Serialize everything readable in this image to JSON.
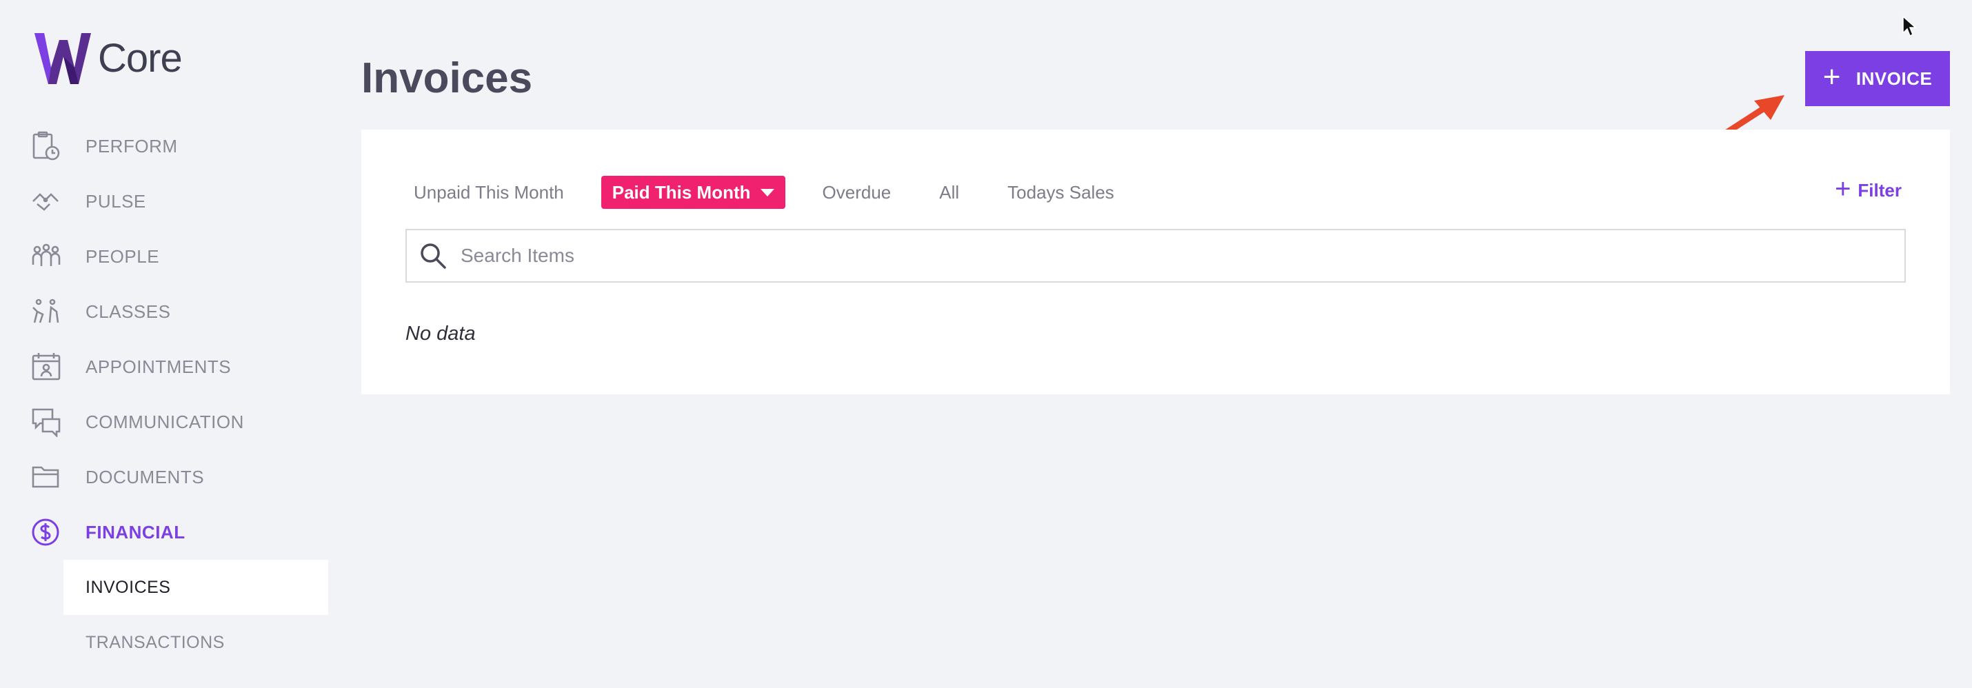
{
  "brand": {
    "logo_text": "Core",
    "accent_color": "#7b3fe4",
    "tab_active_color": "#f0226f"
  },
  "sidebar": {
    "items": [
      {
        "label": "PERFORM",
        "icon": "clipboard-clock-icon"
      },
      {
        "label": "PULSE",
        "icon": "pulse-icon"
      },
      {
        "label": "PEOPLE",
        "icon": "people-group-icon"
      },
      {
        "label": "CLASSES",
        "icon": "classes-figures-icon"
      },
      {
        "label": "APPOINTMENTS",
        "icon": "calendar-person-icon"
      },
      {
        "label": "COMMUNICATION",
        "icon": "chat-bubbles-icon"
      },
      {
        "label": "DOCUMENTS",
        "icon": "folder-icon"
      },
      {
        "label": "FINANCIAL",
        "icon": "dollar-circle-icon",
        "active": true
      }
    ],
    "subitems": [
      {
        "label": "INVOICES",
        "selected": true
      },
      {
        "label": "TRANSACTIONS"
      }
    ]
  },
  "page": {
    "title": "Invoices",
    "add_button_label": "INVOICE",
    "add_button_icon": "plus-icon"
  },
  "tabs": [
    {
      "label": "Unpaid This Month"
    },
    {
      "label": "Paid This Month",
      "active": true
    },
    {
      "label": "Overdue"
    },
    {
      "label": "All"
    },
    {
      "label": "Todays Sales"
    }
  ],
  "filter": {
    "label": "Filter"
  },
  "search": {
    "placeholder": "Search Items",
    "value": ""
  },
  "results": {
    "empty_text": "No data"
  }
}
